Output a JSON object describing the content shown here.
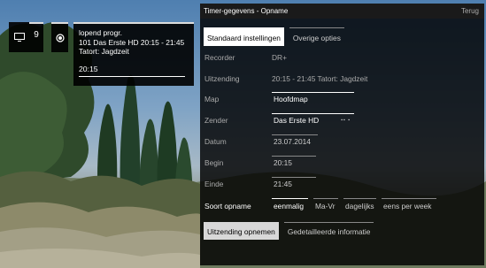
{
  "osd": {
    "channel_number": "9",
    "info_line1": "lopend progr.",
    "info_line2": "101 Das Erste HD 20:15 - 21:45",
    "info_line3": "Tatort: Jagdzeit",
    "time": "20:15",
    "progress": 0.0
  },
  "panel": {
    "title": "Timer-gegevens - Opname",
    "back_label": "Terug",
    "tabs": [
      "Standaard instellingen",
      "Overige opties"
    ],
    "rows": {
      "recorder": {
        "label": "Recorder",
        "value": "DR+"
      },
      "uitzending": {
        "label": "Uitzending",
        "value": "20:15 - 21:45 Tatort: Jagdzeit"
      },
      "map": {
        "label": "Map",
        "value": "Hoofdmap"
      },
      "zender": {
        "label": "Zender",
        "value": "Das Erste HD"
      },
      "datum": {
        "label": "Datum",
        "value": "23.07.2014"
      },
      "begin": {
        "label": "Begin",
        "value": "20:15"
      },
      "einde": {
        "label": "Einde",
        "value": "21:45"
      }
    },
    "soort": {
      "label": "Soort opname",
      "options": [
        "eenmalig",
        "Ma-Vr",
        "dagelijks",
        "eens per week"
      ],
      "selected": "eenmalig"
    },
    "bottom_tabs": [
      "Uitzending opnemen",
      "Gedetailleerde informatie"
    ]
  },
  "colors": {
    "panel_bg": "#000000",
    "accent_white": "#ffffff",
    "label_grey": "#aaaaaa"
  }
}
